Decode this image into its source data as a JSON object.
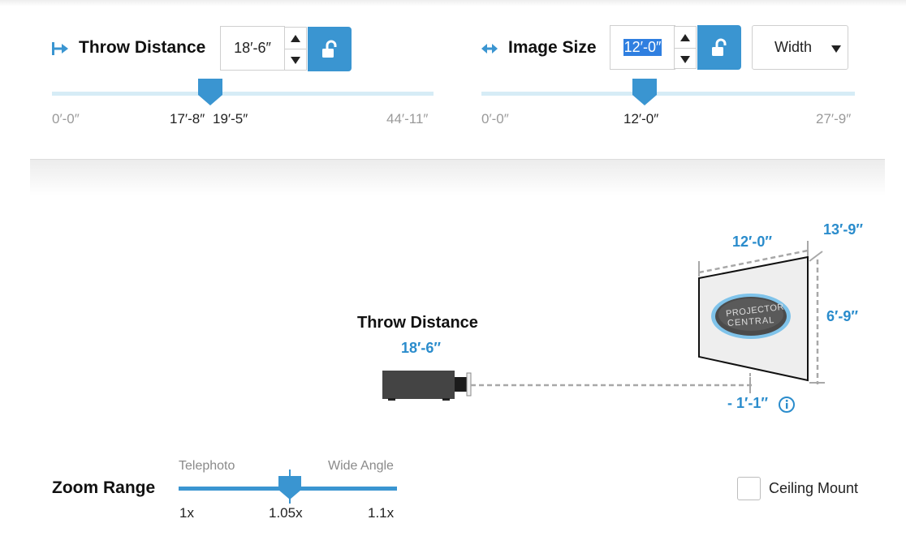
{
  "throw": {
    "label": "Throw Distance",
    "value": "18′-6″",
    "slider": {
      "min": "0′-0″",
      "max": "44′-11″",
      "range_low": "17′-8″",
      "range_high": "19′-5″"
    }
  },
  "image": {
    "label": "Image Size",
    "value": "12′-0″",
    "dimension_select": "Width",
    "slider": {
      "min": "0′-0″",
      "max": "27′-9″",
      "current": "12′-0″"
    }
  },
  "diagram": {
    "throw_label": "Throw Distance",
    "throw_value": "18′-6″",
    "screen_width": "12′-0″",
    "screen_diagonal": "13′-9″",
    "screen_height": "6′-9″",
    "offset": "- 1′-1″",
    "logo_line1": "PROJECTOR",
    "logo_line2": "CENTRAL"
  },
  "zoom": {
    "label": "Zoom Range",
    "left_label": "Telephoto",
    "right_label": "Wide Angle",
    "min": "1x",
    "current": "1.05x",
    "max": "1.1x",
    "position": 0.5
  },
  "ceiling": {
    "label": "Ceiling Mount",
    "checked": false
  },
  "colors": {
    "accent": "#3a95d1",
    "label_blue": "#2a8ccc"
  }
}
